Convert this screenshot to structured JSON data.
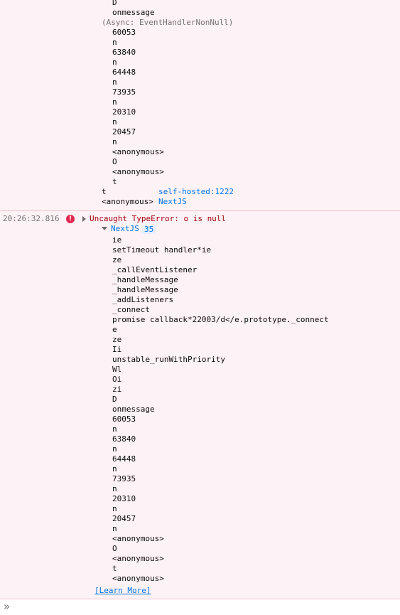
{
  "top_stack": {
    "frames": [
      {
        "name": "D"
      },
      {
        "name": "onmessage"
      },
      {
        "name": "60053"
      },
      {
        "name": "n"
      },
      {
        "name": "63840"
      },
      {
        "name": "n"
      },
      {
        "name": "64448"
      },
      {
        "name": "n"
      },
      {
        "name": "73935"
      },
      {
        "name": "n"
      },
      {
        "name": "20310"
      },
      {
        "name": "n"
      },
      {
        "name": "20457"
      },
      {
        "name": "n"
      },
      {
        "name": "<anonymous>"
      },
      {
        "name": "O"
      },
      {
        "name": "<anonymous>"
      },
      {
        "name": "t"
      }
    ],
    "async_label": "(Async: EventHandlerNonNull)",
    "tail_frames": [
      {
        "name": "t",
        "location": "self-hosted:1222"
      },
      {
        "name": "<anonymous>",
        "location": "NextJS"
      }
    ]
  },
  "error_entry": {
    "timestamp": "20:26:32.816",
    "message": "Uncaught TypeError: o is null",
    "group": {
      "name": "NextJS",
      "count": "35"
    },
    "frames": [
      "ie",
      "setTimeout handler*ie",
      "ze",
      "_callEventListener",
      "_handleMessage",
      "_handleMessage",
      "_addListeners",
      "_connect",
      "promise callback*22003/d</e.prototype._connect",
      "e",
      "ze",
      "Ii",
      "unstable_runWithPriority",
      "Wl",
      "Oi",
      "zi",
      "D",
      "onmessage",
      "60053",
      "n",
      "63840",
      "n",
      "64448",
      "n",
      "73935",
      "n",
      "20310",
      "n",
      "20457",
      "n",
      "<anonymous>",
      "O",
      "<anonymous>",
      "t",
      "<anonymous>"
    ],
    "learn_more": "[Learn More]"
  },
  "console_input": {
    "prompt_icon": "chevrons-right-icon",
    "value": ""
  },
  "colors": {
    "error_background": "#fdf2f5",
    "error_text": "#a4000f",
    "link": "#0074e8",
    "muted": "#737373"
  }
}
